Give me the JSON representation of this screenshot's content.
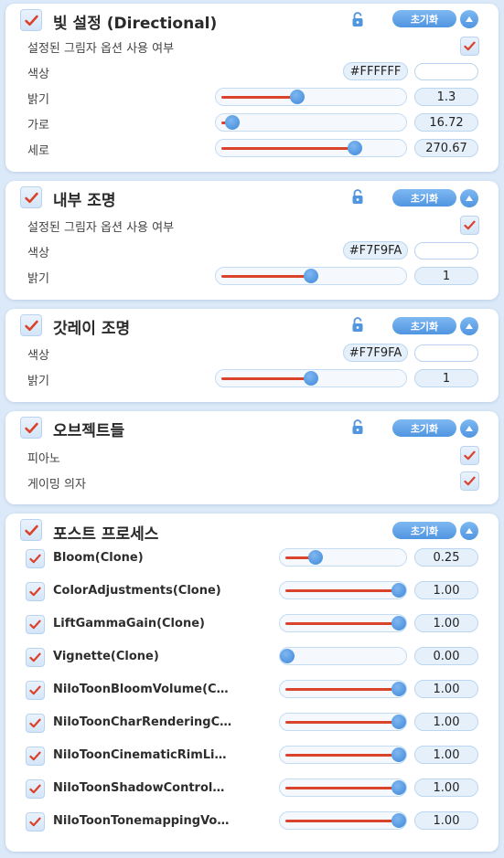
{
  "accent": "#d9432b",
  "brand": "#4f95e0",
  "reset_label": "초기화",
  "directional": {
    "title": "빛 설정 (Directional)",
    "use_shadow_label": "설정된 그림자 옵션 사용 여부",
    "color_label": "색상",
    "color_hex": "#FFFFFF",
    "brightness_label": "밝기",
    "brightness_value": "1.3",
    "brightness_fraction": 0.42,
    "horizontal_label": "가로",
    "horizontal_value": "16.72",
    "horizontal_fraction": 0.05,
    "vertical_label": "세로",
    "vertical_value": "270.67",
    "vertical_fraction": 0.75
  },
  "interior": {
    "title": "내부 조명",
    "use_shadow_label": "설정된 그림자 옵션 사용 여부",
    "color_label": "색상",
    "color_hex": "#F7F9FA",
    "brightness_label": "밝기",
    "brightness_value": "1",
    "brightness_fraction": 0.5
  },
  "gallery": {
    "title": "갓레이 조명",
    "color_label": "색상",
    "color_hex": "#F7F9FA",
    "brightness_label": "밝기",
    "brightness_value": "1",
    "brightness_fraction": 0.5
  },
  "objects": {
    "title": "오브젝트들",
    "items": [
      "피아노",
      "게이밍 의자"
    ]
  },
  "post": {
    "title": "포스트 프로세스",
    "items": [
      {
        "label": "Bloom(Clone)",
        "value": "0.25",
        "fraction": 0.25
      },
      {
        "label": "ColorAdjustments(Clone)",
        "value": "1.00",
        "fraction": 1.0
      },
      {
        "label": "LiftGammaGain(Clone)",
        "value": "1.00",
        "fraction": 1.0
      },
      {
        "label": "Vignette(Clone)",
        "value": "0.00",
        "fraction": 0.0
      },
      {
        "label": "NiloToonBloomVolume(Cl…",
        "value": "1.00",
        "fraction": 1.0
      },
      {
        "label": "NiloToonCharRenderingC…",
        "value": "1.00",
        "fraction": 1.0
      },
      {
        "label": "NiloToonCinematicRimLi…",
        "value": "1.00",
        "fraction": 1.0
      },
      {
        "label": "NiloToonShadowControlV…",
        "value": "1.00",
        "fraction": 1.0
      },
      {
        "label": "NiloToonTonemappingVol…",
        "value": "1.00",
        "fraction": 1.0
      }
    ]
  }
}
